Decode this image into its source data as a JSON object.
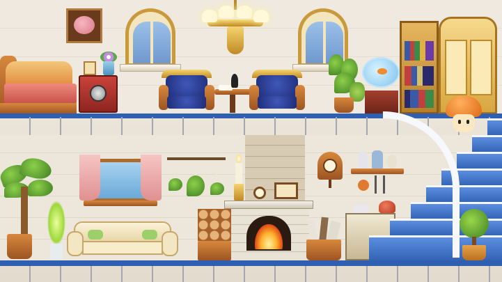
{
  "scene": {
    "type": "side-scrolling room interior",
    "upper_floor": [
      "bed",
      "safe",
      "framed-pig-portrait",
      "flower-vase",
      "arched-window-left",
      "arched-window-right",
      "chandelier",
      "blue-armchair-left",
      "blue-armchair-right",
      "writing-desk",
      "ink-quill",
      "potted-plants",
      "goldfish-bowl",
      "bookshelf",
      "wardrobe"
    ],
    "lower_floor": [
      "palm-plant",
      "glowing-plant",
      "cream-sofa",
      "curtained-window",
      "hanging-macrame-plants",
      "candle",
      "fireplace",
      "picture-frames",
      "firewood-stack",
      "cuckoo-clock",
      "kitchen-shelf",
      "stove",
      "kettle",
      "easel-basket",
      "topiary-plant",
      "staircase"
    ],
    "character": "orange-mushroom",
    "colors": {
      "floor_band": "#2f5fb0",
      "wall": "#efe9df",
      "wood": "#c57532",
      "cushion_blue": "#2a3a96",
      "gold_trim": "#d9a43a",
      "mushroom_cap": "#e77b1f"
    }
  }
}
